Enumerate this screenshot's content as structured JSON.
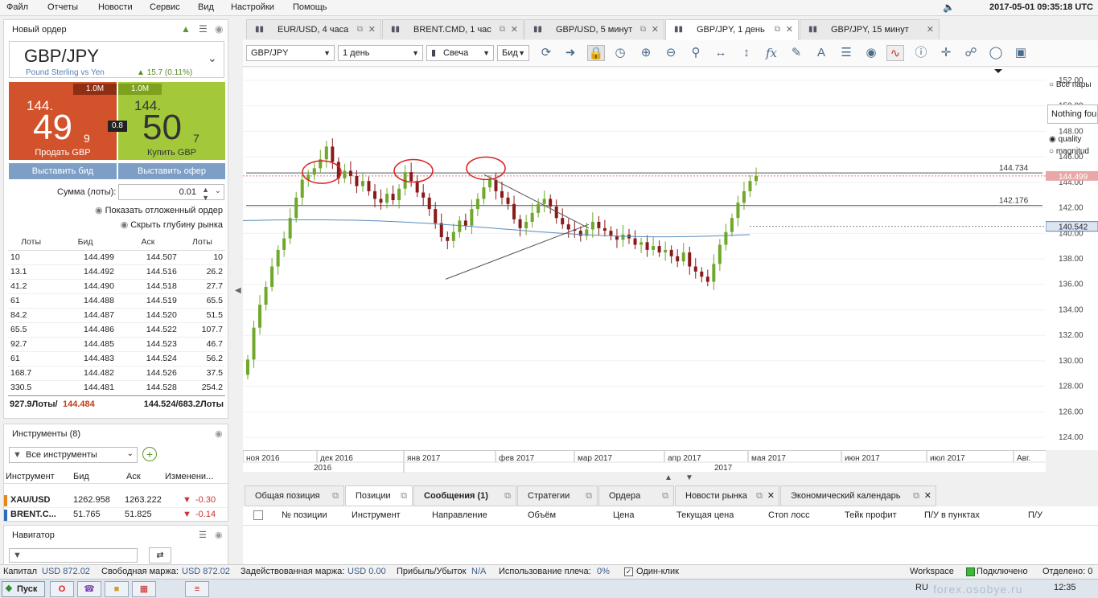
{
  "menu": [
    "Файл",
    "Отчеты",
    "Новости",
    "Сервис",
    "Вид",
    "Настройки",
    "Помощь"
  ],
  "datetime": "2017-05-01 09:35:18 UTC",
  "order": {
    "title": "Новый ордер",
    "symbol": "GBP/JPY",
    "description": "Pound Sterling vs Yen",
    "change": "15.7 (0.11%)",
    "sell": {
      "lots": "1.0M",
      "big_prefix": "144.",
      "big": "49",
      "pip": "9",
      "label": "Продать GBP"
    },
    "buy": {
      "lots": "1.0M",
      "big_prefix": "144.",
      "big": "50",
      "pip": "7",
      "label": "Купить GBP"
    },
    "spread": "0.8",
    "bid_button": "Выставить бид",
    "offer_button": "Выставить офер",
    "amount_label": "Сумма (лоты):",
    "amount_value": "0.01",
    "show_pending": "Показать отложенный ордер",
    "hide_depth": "Скрыть глубину рынка",
    "depth_headers": [
      "Лоты",
      "Бид",
      "Аск",
      "Лоты"
    ],
    "depth_rows": [
      [
        "10",
        "144.499",
        "144.507",
        "10"
      ],
      [
        "13.1",
        "144.492",
        "144.516",
        "26.2"
      ],
      [
        "41.2",
        "144.490",
        "144.518",
        "27.7"
      ],
      [
        "61",
        "144.488",
        "144.519",
        "65.5"
      ],
      [
        "84.2",
        "144.487",
        "144.520",
        "51.5"
      ],
      [
        "65.5",
        "144.486",
        "144.522",
        "107.7"
      ],
      [
        "92.7",
        "144.485",
        "144.523",
        "46.7"
      ],
      [
        "61",
        "144.483",
        "144.524",
        "56.2"
      ],
      [
        "168.7",
        "144.482",
        "144.526",
        "37.5"
      ],
      [
        "330.5",
        "144.481",
        "144.528",
        "254.2"
      ]
    ],
    "total_bid_lots": "927.9Лоты/",
    "total_bid_price": "144.484",
    "total_ask": "144.524/683.2Лоты"
  },
  "instruments": {
    "title": "Инструменты (8)",
    "filter": "Все инструменты",
    "headers": [
      "Инструмент",
      "Бид",
      "Аск",
      "Изменени..."
    ],
    "rows": [
      {
        "name": "XAU/USD",
        "bid": "1262.958",
        "ask": "1263.222",
        "change": "-0.30"
      },
      {
        "name": "BRENT.C...",
        "bid": "51.765",
        "ask": "51.825",
        "change": "-0.14"
      }
    ]
  },
  "navigator": {
    "title": "Навигатор"
  },
  "tabs": [
    {
      "label": "EUR/USD, 4 часа"
    },
    {
      "label": "BRENT.CMD, 1 час"
    },
    {
      "label": "GBP/USD, 5 минут"
    },
    {
      "label": "GBP/JPY, 1 день"
    },
    {
      "label": "GBP/JPY, 15 минут"
    }
  ],
  "toolbar": {
    "instrument": "GBP/JPY",
    "period": "1 день",
    "type": "Свеча",
    "side": "Бид"
  },
  "right_panel": {
    "opt1": "Все пары",
    "search": "Nothing fou",
    "opt2": "quality",
    "opt3": "magnitud"
  },
  "chart_data": {
    "type": "candlestick",
    "y_ticks": [
      "152.00",
      "150.00",
      "148.00",
      "146.00",
      "144.00",
      "142.00",
      "140.00",
      "138.00",
      "136.00",
      "134.00",
      "132.00",
      "130.00",
      "128.00",
      "126.00",
      "124.00"
    ],
    "ylim": [
      123,
      153
    ],
    "x_ticks": [
      "ноя 2016",
      "дек 2016",
      "янв 2017",
      "фев 2017",
      "мар 2017",
      "апр 2017",
      "мая 2017",
      "июн 2017",
      "июл 2017",
      "Авг."
    ],
    "years": [
      "2016",
      "2017"
    ],
    "levels": [
      {
        "label": "144.734",
        "value": 144.734
      },
      {
        "label": "142.176",
        "value": 142.176
      }
    ],
    "current_bid": "144.499",
    "ma_value": "140.542",
    "closes": [
      130.1,
      132.6,
      134.4,
      135.8,
      137.4,
      138.7,
      139.6,
      141.2,
      142.8,
      144.2,
      144.6,
      145.1,
      145.8,
      146.8,
      145.6,
      144.3,
      144.9,
      144.5,
      143.7,
      144.1,
      143.3,
      142.7,
      142.4,
      143.1,
      142.6,
      143.5,
      144.8,
      144.1,
      143.2,
      142.8,
      141.9,
      140.8,
      139.7,
      139.4,
      140.1,
      141.0,
      140.6,
      141.9,
      142.7,
      143.6,
      144.2,
      143.3,
      142.8,
      142.3,
      141.1,
      140.4,
      140.9,
      141.6,
      142.3,
      142.7,
      142.1,
      141.2,
      140.7,
      140.3,
      140.2,
      139.8,
      140.3,
      140.9,
      140.4,
      140.2,
      139.8,
      139.5,
      139.9,
      139.6,
      139.1,
      139.3,
      138.7,
      139.0,
      138.5,
      138.7,
      138.2,
      137.8,
      138.5,
      137.4,
      137.0,
      136.6,
      136.2,
      137.6,
      139.1,
      140.1,
      141.2,
      142.4,
      143.3,
      144.1,
      144.5
    ]
  },
  "bottom_tabs": [
    "Общая позиция",
    "Позиции",
    "Сообщения (1)",
    "Стратегии",
    "Ордера",
    "Новости рынка",
    "Экономический календарь"
  ],
  "grid_headers": [
    "№ позиции",
    "Инструмент",
    "Направление",
    "Объём",
    "Цена",
    "Текущая цена",
    "Стоп лосс",
    "Тейк профит",
    "П/У в пунктах",
    "П/У"
  ],
  "status": {
    "capital_label": "Капитал",
    "capital": "USD 872.02",
    "free_margin_label": "Свободная маржа:",
    "free_margin": "USD 872.02",
    "used_margin_label": "Задействованная маржа:",
    "used_margin": "USD 0.00",
    "pl_label": "Прибыль/Убыток",
    "pl": "N/A",
    "leverage_label": "Использование плеча:",
    "leverage": "0%",
    "oneclick": "Один-клик",
    "workspace": "Workspace",
    "connected": "Подключено",
    "detached": "Отделено: 0"
  },
  "taskbar": {
    "start": "Пуск",
    "lang": "RU",
    "time": "12:35",
    "watermark": "forex.osobye.ru"
  }
}
